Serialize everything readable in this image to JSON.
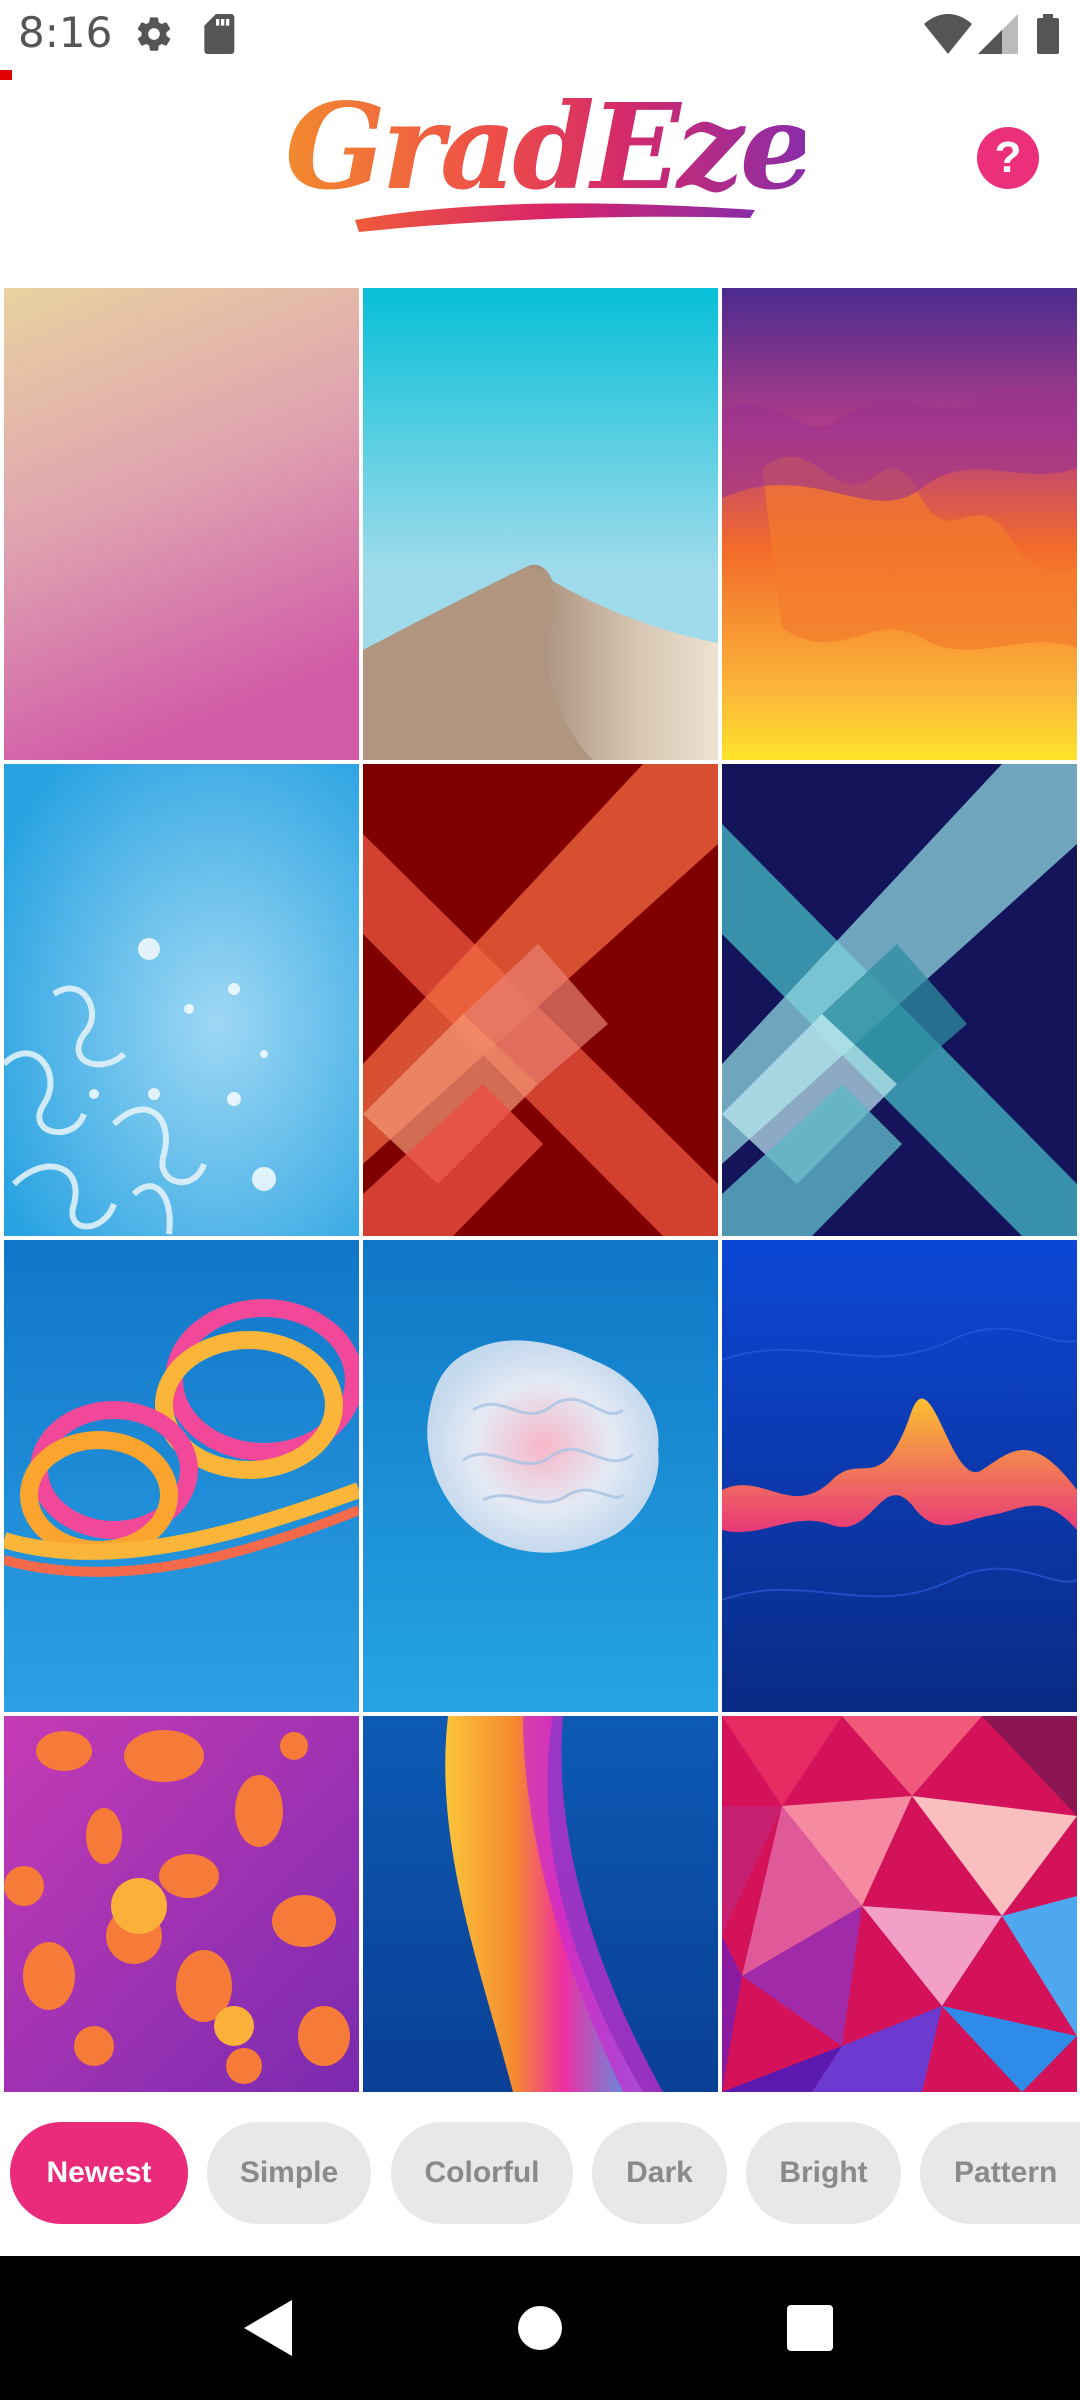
{
  "status_bar": {
    "time": "8:16",
    "icons": [
      "gear-icon",
      "sd-card-icon",
      "wifi-icon",
      "signal-icon",
      "battery-icon"
    ]
  },
  "header": {
    "logo_text": "GradEze",
    "help_icon": "?"
  },
  "wallpapers": [
    {
      "name": "peach-pink-gradient"
    },
    {
      "name": "desert-dune"
    },
    {
      "name": "fire-flames"
    },
    {
      "name": "blue-tentacles-bubbles"
    },
    {
      "name": "red-diamond-ribbons"
    },
    {
      "name": "teal-diamond-ribbons"
    },
    {
      "name": "orange-pink-rings"
    },
    {
      "name": "coral-flower"
    },
    {
      "name": "sound-wave"
    },
    {
      "name": "orange-blobs"
    },
    {
      "name": "rainbow-ribbon"
    },
    {
      "name": "low-poly-mosaic"
    }
  ],
  "categories": [
    {
      "label": "Newest",
      "active": true
    },
    {
      "label": "Simple",
      "active": false
    },
    {
      "label": "Colorful",
      "active": false
    },
    {
      "label": "Dark",
      "active": false
    },
    {
      "label": "Bright",
      "active": false
    },
    {
      "label": "Pattern",
      "active": false
    }
  ],
  "colors": {
    "accent": "#ea2a7a",
    "chip_inactive": "#e8e8e8"
  },
  "navbar": {
    "buttons": [
      "back-icon",
      "home-icon",
      "recents-icon"
    ]
  }
}
